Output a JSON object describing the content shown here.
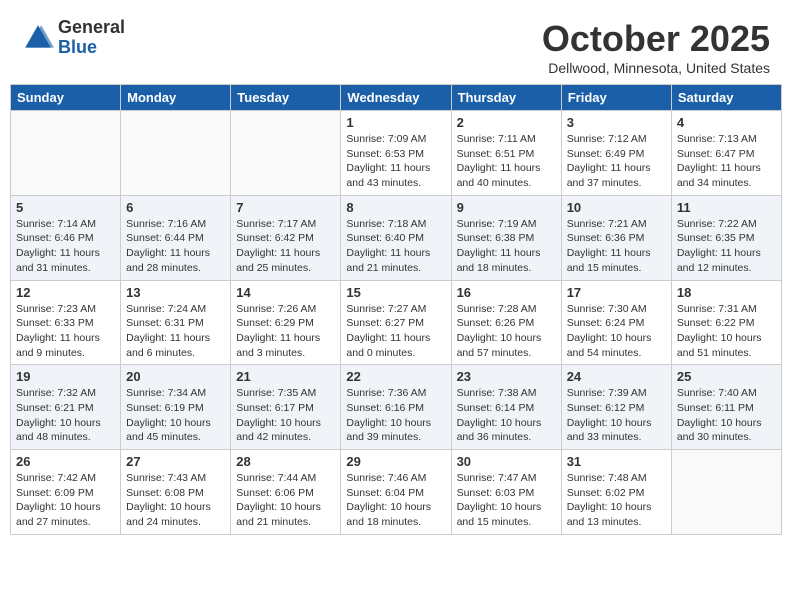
{
  "header": {
    "logo_general": "General",
    "logo_blue": "Blue",
    "month": "October 2025",
    "location": "Dellwood, Minnesota, United States"
  },
  "weekdays": [
    "Sunday",
    "Monday",
    "Tuesday",
    "Wednesday",
    "Thursday",
    "Friday",
    "Saturday"
  ],
  "weeks": [
    [
      {
        "day": "",
        "info": ""
      },
      {
        "day": "",
        "info": ""
      },
      {
        "day": "",
        "info": ""
      },
      {
        "day": "1",
        "info": "Sunrise: 7:09 AM\nSunset: 6:53 PM\nDaylight: 11 hours\nand 43 minutes."
      },
      {
        "day": "2",
        "info": "Sunrise: 7:11 AM\nSunset: 6:51 PM\nDaylight: 11 hours\nand 40 minutes."
      },
      {
        "day": "3",
        "info": "Sunrise: 7:12 AM\nSunset: 6:49 PM\nDaylight: 11 hours\nand 37 minutes."
      },
      {
        "day": "4",
        "info": "Sunrise: 7:13 AM\nSunset: 6:47 PM\nDaylight: 11 hours\nand 34 minutes."
      }
    ],
    [
      {
        "day": "5",
        "info": "Sunrise: 7:14 AM\nSunset: 6:46 PM\nDaylight: 11 hours\nand 31 minutes."
      },
      {
        "day": "6",
        "info": "Sunrise: 7:16 AM\nSunset: 6:44 PM\nDaylight: 11 hours\nand 28 minutes."
      },
      {
        "day": "7",
        "info": "Sunrise: 7:17 AM\nSunset: 6:42 PM\nDaylight: 11 hours\nand 25 minutes."
      },
      {
        "day": "8",
        "info": "Sunrise: 7:18 AM\nSunset: 6:40 PM\nDaylight: 11 hours\nand 21 minutes."
      },
      {
        "day": "9",
        "info": "Sunrise: 7:19 AM\nSunset: 6:38 PM\nDaylight: 11 hours\nand 18 minutes."
      },
      {
        "day": "10",
        "info": "Sunrise: 7:21 AM\nSunset: 6:36 PM\nDaylight: 11 hours\nand 15 minutes."
      },
      {
        "day": "11",
        "info": "Sunrise: 7:22 AM\nSunset: 6:35 PM\nDaylight: 11 hours\nand 12 minutes."
      }
    ],
    [
      {
        "day": "12",
        "info": "Sunrise: 7:23 AM\nSunset: 6:33 PM\nDaylight: 11 hours\nand 9 minutes."
      },
      {
        "day": "13",
        "info": "Sunrise: 7:24 AM\nSunset: 6:31 PM\nDaylight: 11 hours\nand 6 minutes."
      },
      {
        "day": "14",
        "info": "Sunrise: 7:26 AM\nSunset: 6:29 PM\nDaylight: 11 hours\nand 3 minutes."
      },
      {
        "day": "15",
        "info": "Sunrise: 7:27 AM\nSunset: 6:27 PM\nDaylight: 11 hours\nand 0 minutes."
      },
      {
        "day": "16",
        "info": "Sunrise: 7:28 AM\nSunset: 6:26 PM\nDaylight: 10 hours\nand 57 minutes."
      },
      {
        "day": "17",
        "info": "Sunrise: 7:30 AM\nSunset: 6:24 PM\nDaylight: 10 hours\nand 54 minutes."
      },
      {
        "day": "18",
        "info": "Sunrise: 7:31 AM\nSunset: 6:22 PM\nDaylight: 10 hours\nand 51 minutes."
      }
    ],
    [
      {
        "day": "19",
        "info": "Sunrise: 7:32 AM\nSunset: 6:21 PM\nDaylight: 10 hours\nand 48 minutes."
      },
      {
        "day": "20",
        "info": "Sunrise: 7:34 AM\nSunset: 6:19 PM\nDaylight: 10 hours\nand 45 minutes."
      },
      {
        "day": "21",
        "info": "Sunrise: 7:35 AM\nSunset: 6:17 PM\nDaylight: 10 hours\nand 42 minutes."
      },
      {
        "day": "22",
        "info": "Sunrise: 7:36 AM\nSunset: 6:16 PM\nDaylight: 10 hours\nand 39 minutes."
      },
      {
        "day": "23",
        "info": "Sunrise: 7:38 AM\nSunset: 6:14 PM\nDaylight: 10 hours\nand 36 minutes."
      },
      {
        "day": "24",
        "info": "Sunrise: 7:39 AM\nSunset: 6:12 PM\nDaylight: 10 hours\nand 33 minutes."
      },
      {
        "day": "25",
        "info": "Sunrise: 7:40 AM\nSunset: 6:11 PM\nDaylight: 10 hours\nand 30 minutes."
      }
    ],
    [
      {
        "day": "26",
        "info": "Sunrise: 7:42 AM\nSunset: 6:09 PM\nDaylight: 10 hours\nand 27 minutes."
      },
      {
        "day": "27",
        "info": "Sunrise: 7:43 AM\nSunset: 6:08 PM\nDaylight: 10 hours\nand 24 minutes."
      },
      {
        "day": "28",
        "info": "Sunrise: 7:44 AM\nSunset: 6:06 PM\nDaylight: 10 hours\nand 21 minutes."
      },
      {
        "day": "29",
        "info": "Sunrise: 7:46 AM\nSunset: 6:04 PM\nDaylight: 10 hours\nand 18 minutes."
      },
      {
        "day": "30",
        "info": "Sunrise: 7:47 AM\nSunset: 6:03 PM\nDaylight: 10 hours\nand 15 minutes."
      },
      {
        "day": "31",
        "info": "Sunrise: 7:48 AM\nSunset: 6:02 PM\nDaylight: 10 hours\nand 13 minutes."
      },
      {
        "day": "",
        "info": ""
      }
    ]
  ]
}
